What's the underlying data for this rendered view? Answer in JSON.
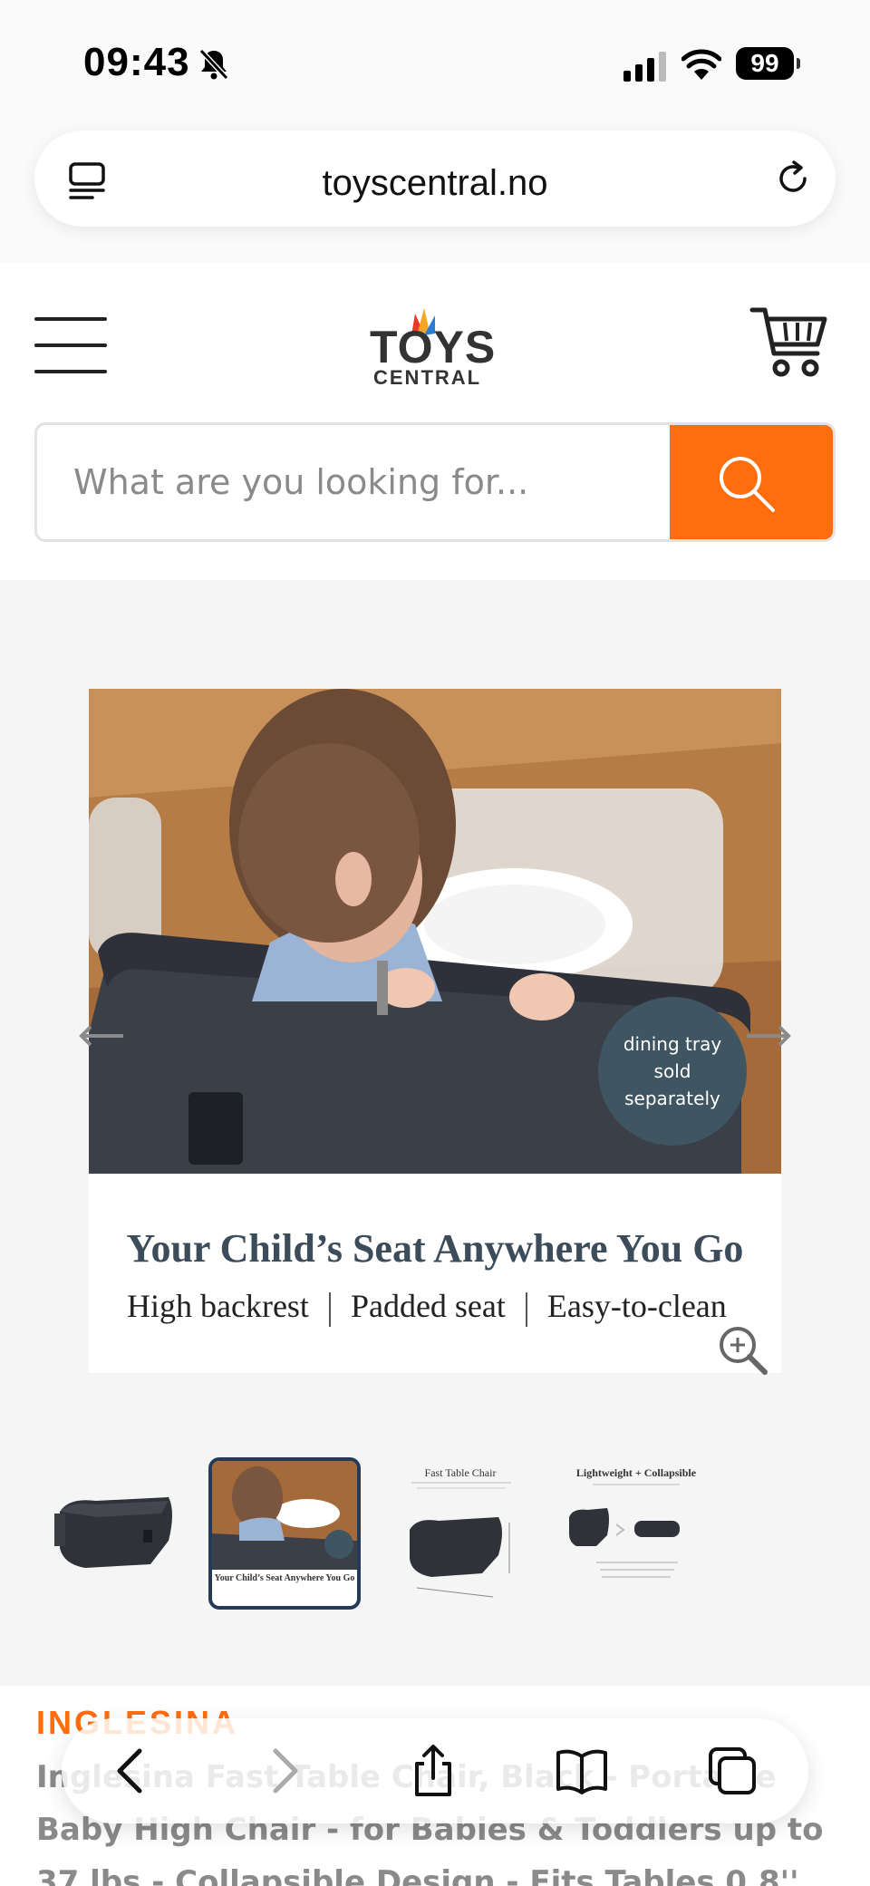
{
  "status": {
    "time": "09:43",
    "battery": "99"
  },
  "browser": {
    "url": "toyscentral.no"
  },
  "site": {
    "logo_top": "TOYS",
    "logo_bottom": "CENTRAL",
    "search_placeholder": "What are you looking for..."
  },
  "gallery": {
    "badge": "dining tray sold separately",
    "slide_title": "Your Child’s Seat Anywhere You Go",
    "features": [
      "High backrest",
      "Padded seat",
      "Easy-to-clean"
    ],
    "thumbnails": [
      {
        "label": ""
      },
      {
        "label": "Your Child’s Seat Anywhere You Go"
      },
      {
        "label": "Fast Table Chair"
      },
      {
        "label": "Lightweight + Collapsible"
      }
    ],
    "active_index": 1
  },
  "product": {
    "brand": "INGLESINA",
    "title": "Inglesina Fast Table Chair, Black - Portable Baby High Chair - for Babies & Toddlers up to 37 lbs - Collapsible Design - Fits Tables 0.8''"
  },
  "colors": {
    "accent": "#ff6d0f",
    "badge": "#3f5562",
    "title": "#3c4c5a"
  }
}
